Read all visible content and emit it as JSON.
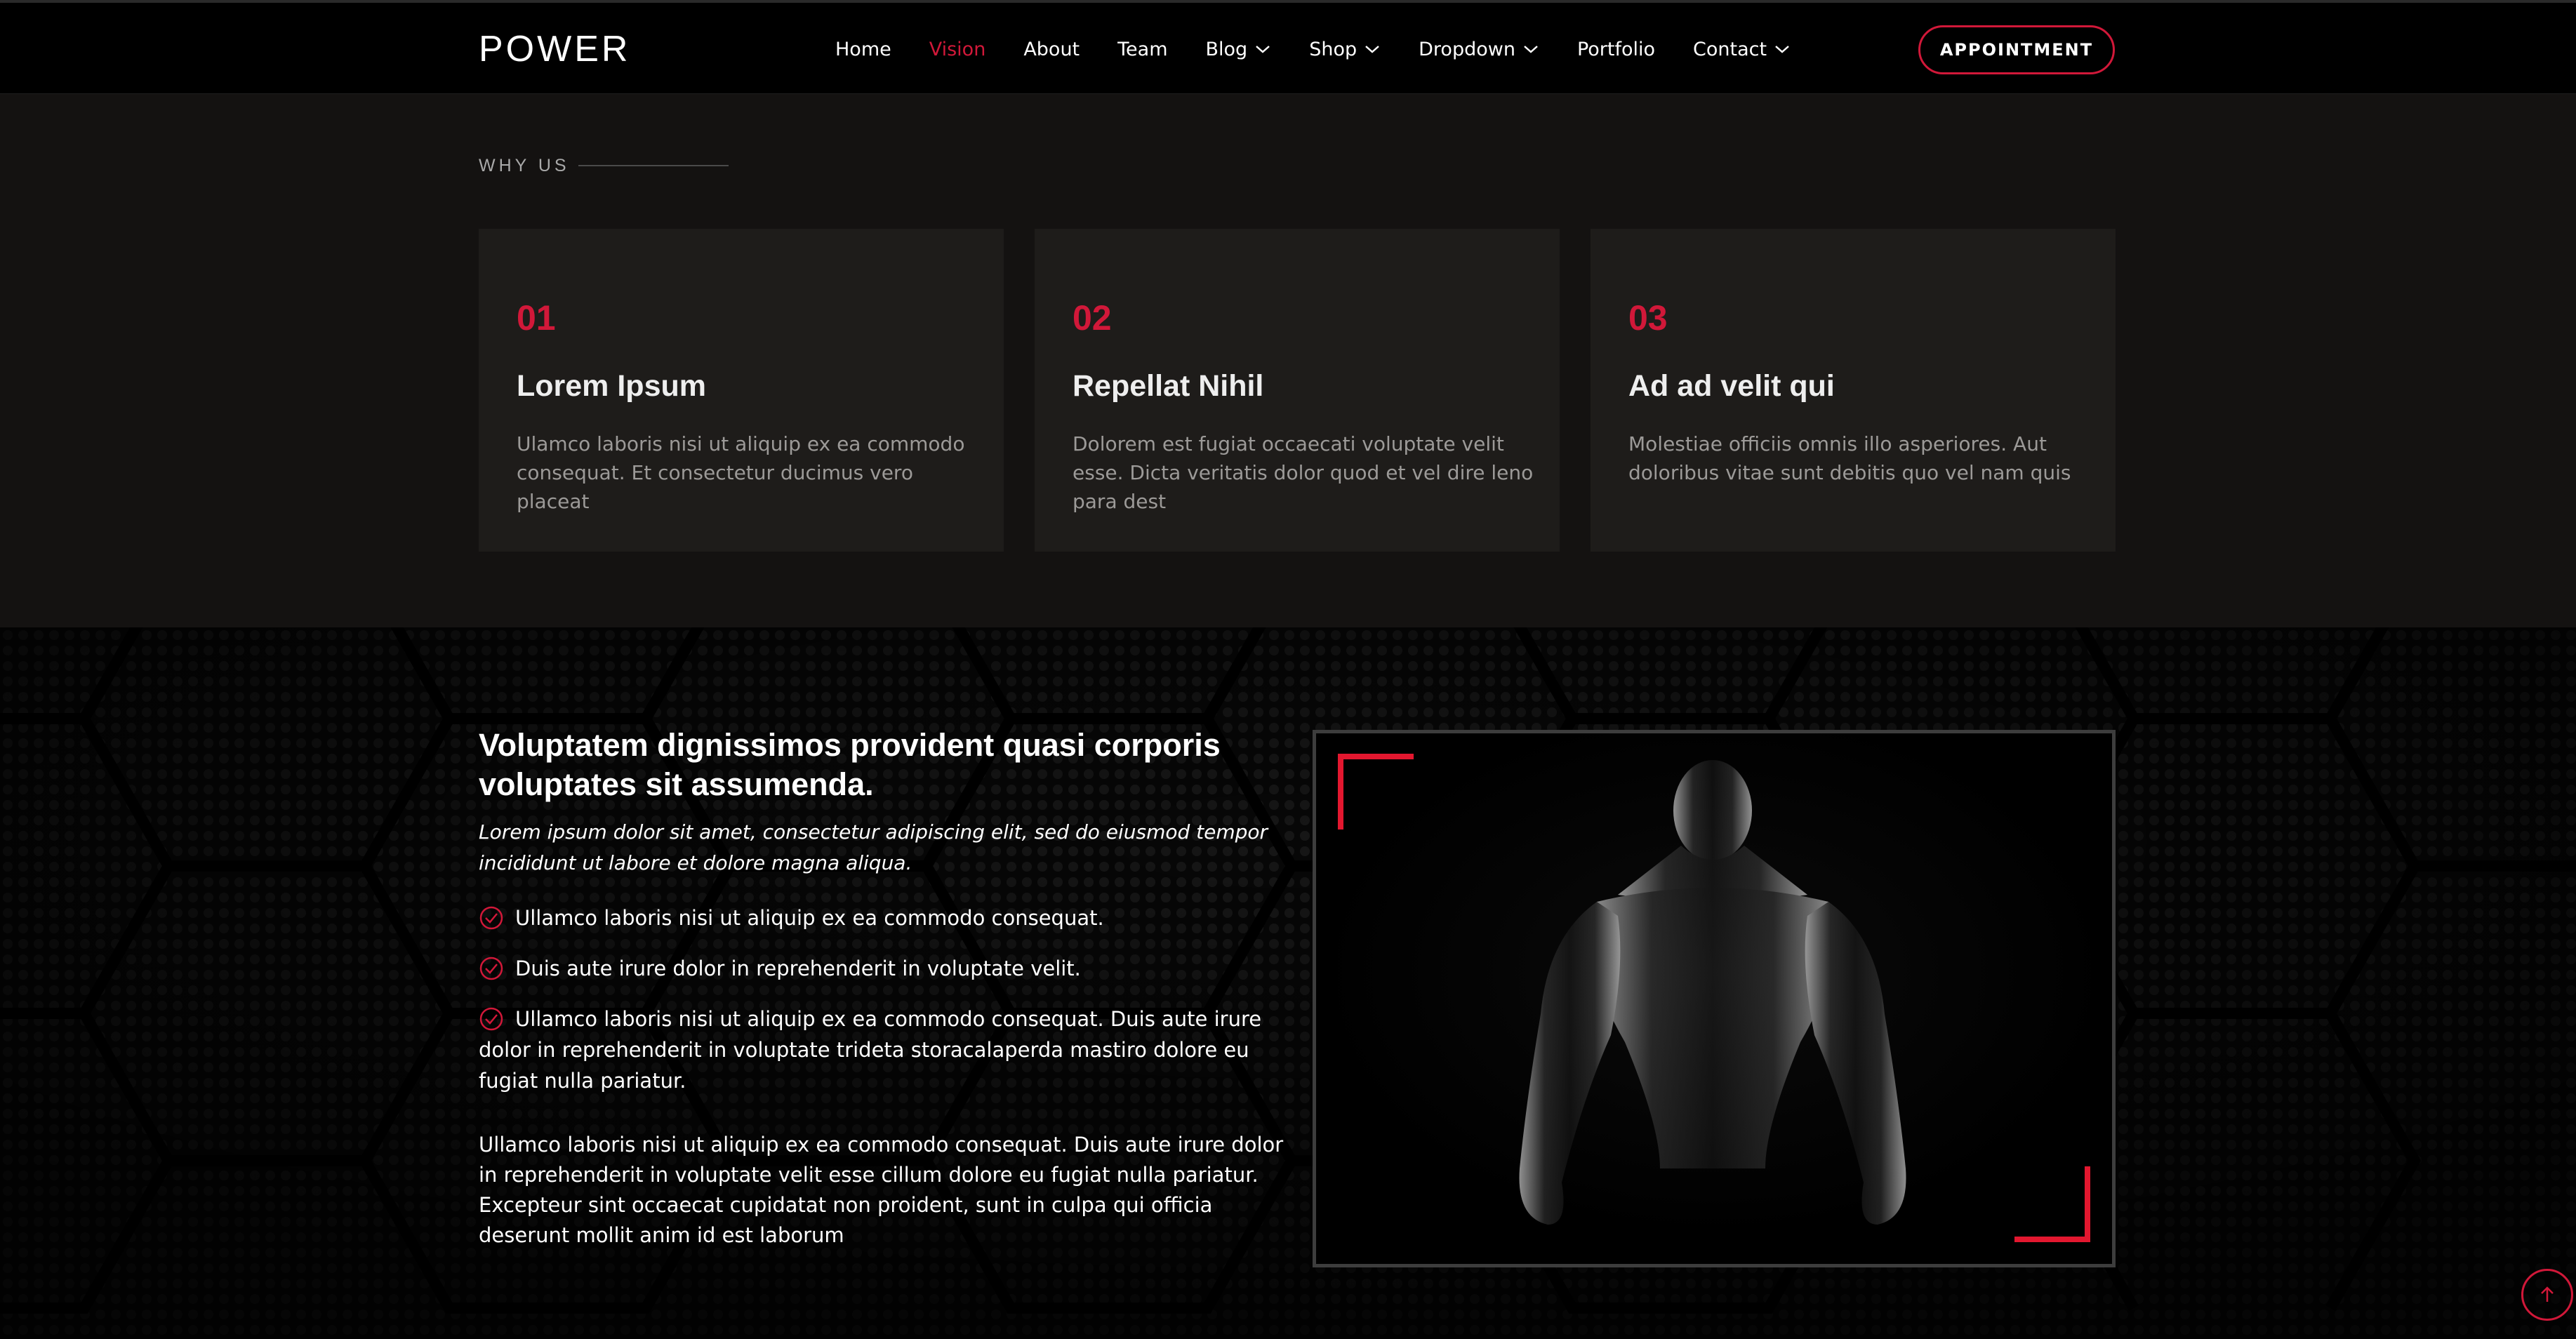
{
  "header": {
    "logo": "POWER",
    "nav": [
      {
        "label": "Home"
      },
      {
        "label": "Vision"
      },
      {
        "label": "About"
      },
      {
        "label": "Team"
      },
      {
        "label": "Blog"
      },
      {
        "label": "Shop"
      },
      {
        "label": "Dropdown"
      },
      {
        "label": "Portfolio"
      },
      {
        "label": "Contact"
      }
    ],
    "active_nav": "Vision",
    "appointment_label": "APPOINTMENT"
  },
  "why_us": {
    "label": "WHY US",
    "cards": [
      {
        "num": "01",
        "title": "Lorem Ipsum",
        "desc": "Ulamco laboris nisi ut aliquip ex ea commodo consequat. Et consectetur ducimus vero placeat"
      },
      {
        "num": "02",
        "title": "Repellat Nihil",
        "desc": "Dolorem est fugiat occaecati voluptate velit esse. Dicta veritatis dolor quod et vel dire leno para dest"
      },
      {
        "num": "03",
        "title": "Ad ad velit qui",
        "desc": "Molestiae officiis omnis illo asperiores. Aut doloribus vitae sunt debitis quo vel nam quis"
      }
    ]
  },
  "about": {
    "title": "Voluptatem dignissimos provident quasi corporis voluptates sit assumenda.",
    "italic": "Lorem ipsum dolor sit amet, consectetur adipiscing elit, sed do eiusmod tempor incididunt ut labore et dolore magna aliqua.",
    "checks": [
      "Ullamco laboris nisi ut aliquip ex ea commodo consequat.",
      "Duis aute irure dolor in reprehenderit in voluptate velit.",
      "Ullamco laboris nisi ut aliquip ex ea commodo consequat. Duis aute irure dolor in reprehenderit in voluptate trideta storacalaperda mastiro dolore eu fugiat nulla pariatur."
    ],
    "paragraph": "Ullamco laboris nisi ut aliquip ex ea commodo consequat. Duis aute irure dolor in reprehenderit in voluptate velit esse cillum dolore eu fugiat nulla pariatur. Excepteur sint occaecat cupidatat non proident, sunt in culpa qui officia deserunt mollit anim id est laborum"
  },
  "colors": {
    "accent": "#d11839",
    "corner": "#e3172f",
    "background": "#141211",
    "card": "#1e1c1a"
  },
  "icons": {
    "check": "check-circle-icon",
    "scroll_top": "arrow-up-icon",
    "chevron": "chevron-down-icon"
  }
}
